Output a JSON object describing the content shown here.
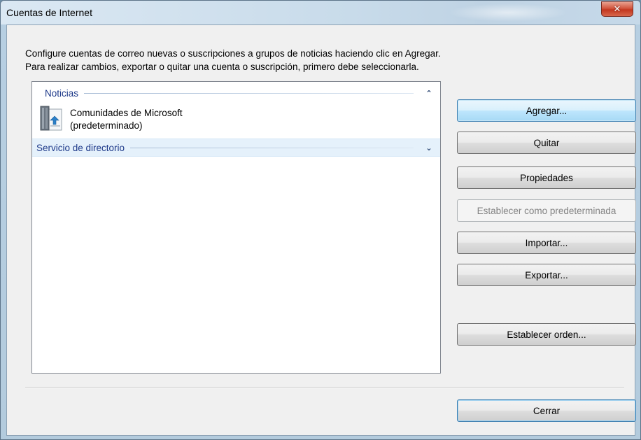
{
  "window": {
    "title": "Cuentas de Internet",
    "close_glyph": "✕"
  },
  "instructions": {
    "line1": "Configure cuentas de correo nuevas o suscripciones a grupos de noticias haciendo clic en Agregar.",
    "line2": "Para realizar cambios, exportar o quitar una cuenta o suscripción, primero debe seleccionarla."
  },
  "accounts_list": {
    "groups": [
      {
        "label": "Noticias",
        "chevron": "⌃",
        "expanded": true,
        "items": [
          {
            "name_line1": "Comunidades de Microsoft",
            "name_line2": "(predeterminado)",
            "icon": "newsgroup-account-icon"
          }
        ]
      },
      {
        "label": "Servicio de directorio",
        "chevron": "⌄",
        "expanded": false,
        "selected": true
      }
    ]
  },
  "buttons": {
    "add": {
      "label": "Agregar...",
      "state": "focused"
    },
    "remove": {
      "label": "Quitar",
      "state": "normal"
    },
    "properties": {
      "label": "Propiedades",
      "state": "normal"
    },
    "set_default": {
      "label": "Establecer como predeterminada",
      "state": "disabled"
    },
    "import": {
      "label": "Importar...",
      "state": "normal"
    },
    "export": {
      "label": "Exportar...",
      "state": "normal"
    },
    "set_order": {
      "label": "Establecer orden...",
      "state": "normal"
    },
    "close": {
      "label": "Cerrar",
      "state": "default"
    }
  },
  "colors": {
    "group_header_text": "#1e3a8a",
    "accent_border": "#3c7fb1",
    "close_button_red": "#c2361e"
  }
}
